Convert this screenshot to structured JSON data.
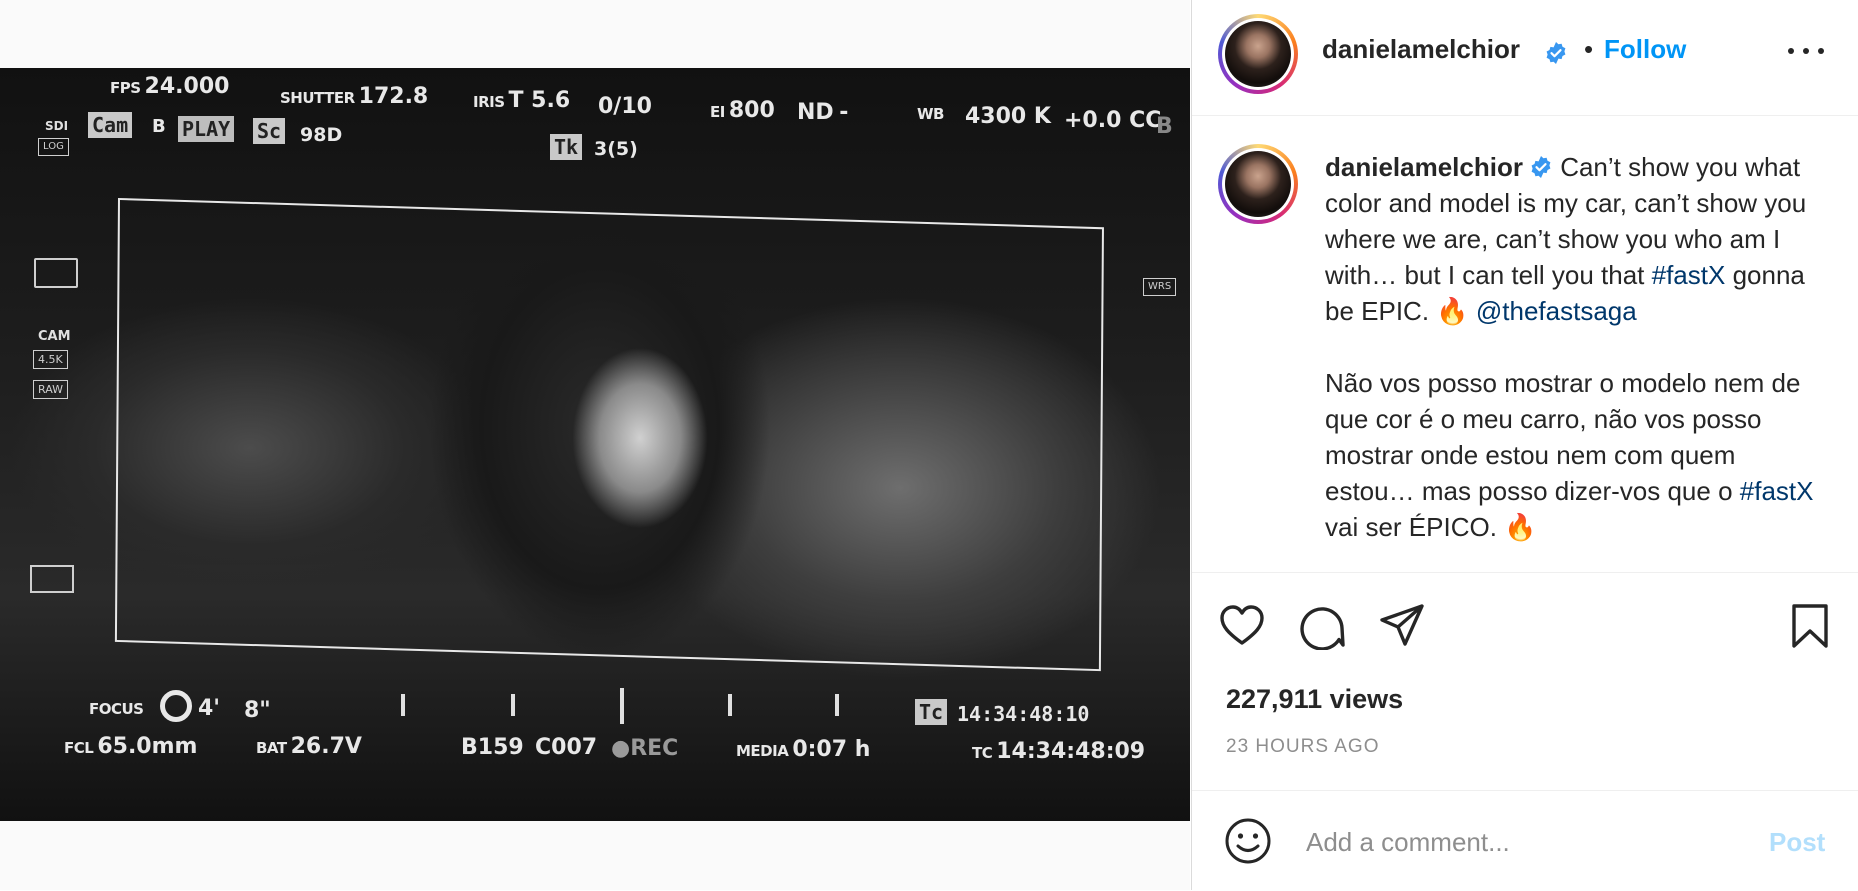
{
  "video": {
    "hud": {
      "fps_label": "FPS",
      "fps_value": "24.000",
      "shutter_label": "SHUTTER",
      "shutter_value": "172.8",
      "iris_label": "IRIS",
      "iris_value": "T 5.6",
      "iris_frac": "0/10",
      "ei_label": "EI",
      "ei_value": "800",
      "nd_label": "ND",
      "nd_value": "-",
      "wb_label": "WB",
      "wb_value": "4300 K",
      "cc_value": "+0.0 CC",
      "b_marker": "B",
      "sdi": "SDI",
      "log": "LOG",
      "cam_box": "Cam",
      "cam_value": "B",
      "play": "PLAY",
      "sc_box": "Sc",
      "sc_value": "98D",
      "tk_box": "Tk",
      "tk_value": "3(5)",
      "wrs": "WRS",
      "cam_side": "CAM",
      "res": "4.5K",
      "raw": "RAW",
      "focus_label": "FOCUS",
      "focus_value_ft": "4'",
      "focus_value_in": "8\"",
      "fcl_label": "FCL",
      "fcl_value": "65.0mm",
      "bat_label": "BAT",
      "bat_value": "26.7V",
      "reel": "B159",
      "clip": "C007",
      "rec": "●REC",
      "media_label": "MEDIA",
      "media_value": "0:07 h",
      "tc_box": "Tc",
      "tc_box_value": "14:34:48:10",
      "tc_label": "TC",
      "tc_value": "14:34:48:09"
    }
  },
  "header": {
    "username": "danielamelchior",
    "separator": "•",
    "follow_label": "Follow"
  },
  "caption": {
    "username": "danielamelchior",
    "text_1": " Can’t show you what color and model is my car, can’t show you where we are, can’t show you who am I with… but I can tell you that ",
    "hashtag_1": "#fastX",
    "text_2": " gonna be EPIC. 🔥 ",
    "mention": "@thefastsaga",
    "text_3": "Não vos posso mostrar o modelo nem de que cor é o meu carro, não vos posso mostrar onde estou nem com quem estou… mas posso dizer-vos que o ",
    "hashtag_2": "#fastX",
    "text_4": " vai ser ÉPICO. 🔥"
  },
  "stats": {
    "views": "227,911 views",
    "time_ago": "23 HOURS AGO"
  },
  "comment": {
    "placeholder": "Add a comment...",
    "post_label": "Post"
  },
  "icons": {
    "like": "heart-icon",
    "comment": "comment-icon",
    "share": "send-icon",
    "save": "bookmark-icon",
    "emoji": "emoji-icon",
    "more": "more-icon",
    "verified": "verified-badge-icon"
  },
  "colors": {
    "accent": "#0095f6",
    "link": "#00376b",
    "post_disabled": "#b2dffc",
    "verified": "#3897f0"
  }
}
